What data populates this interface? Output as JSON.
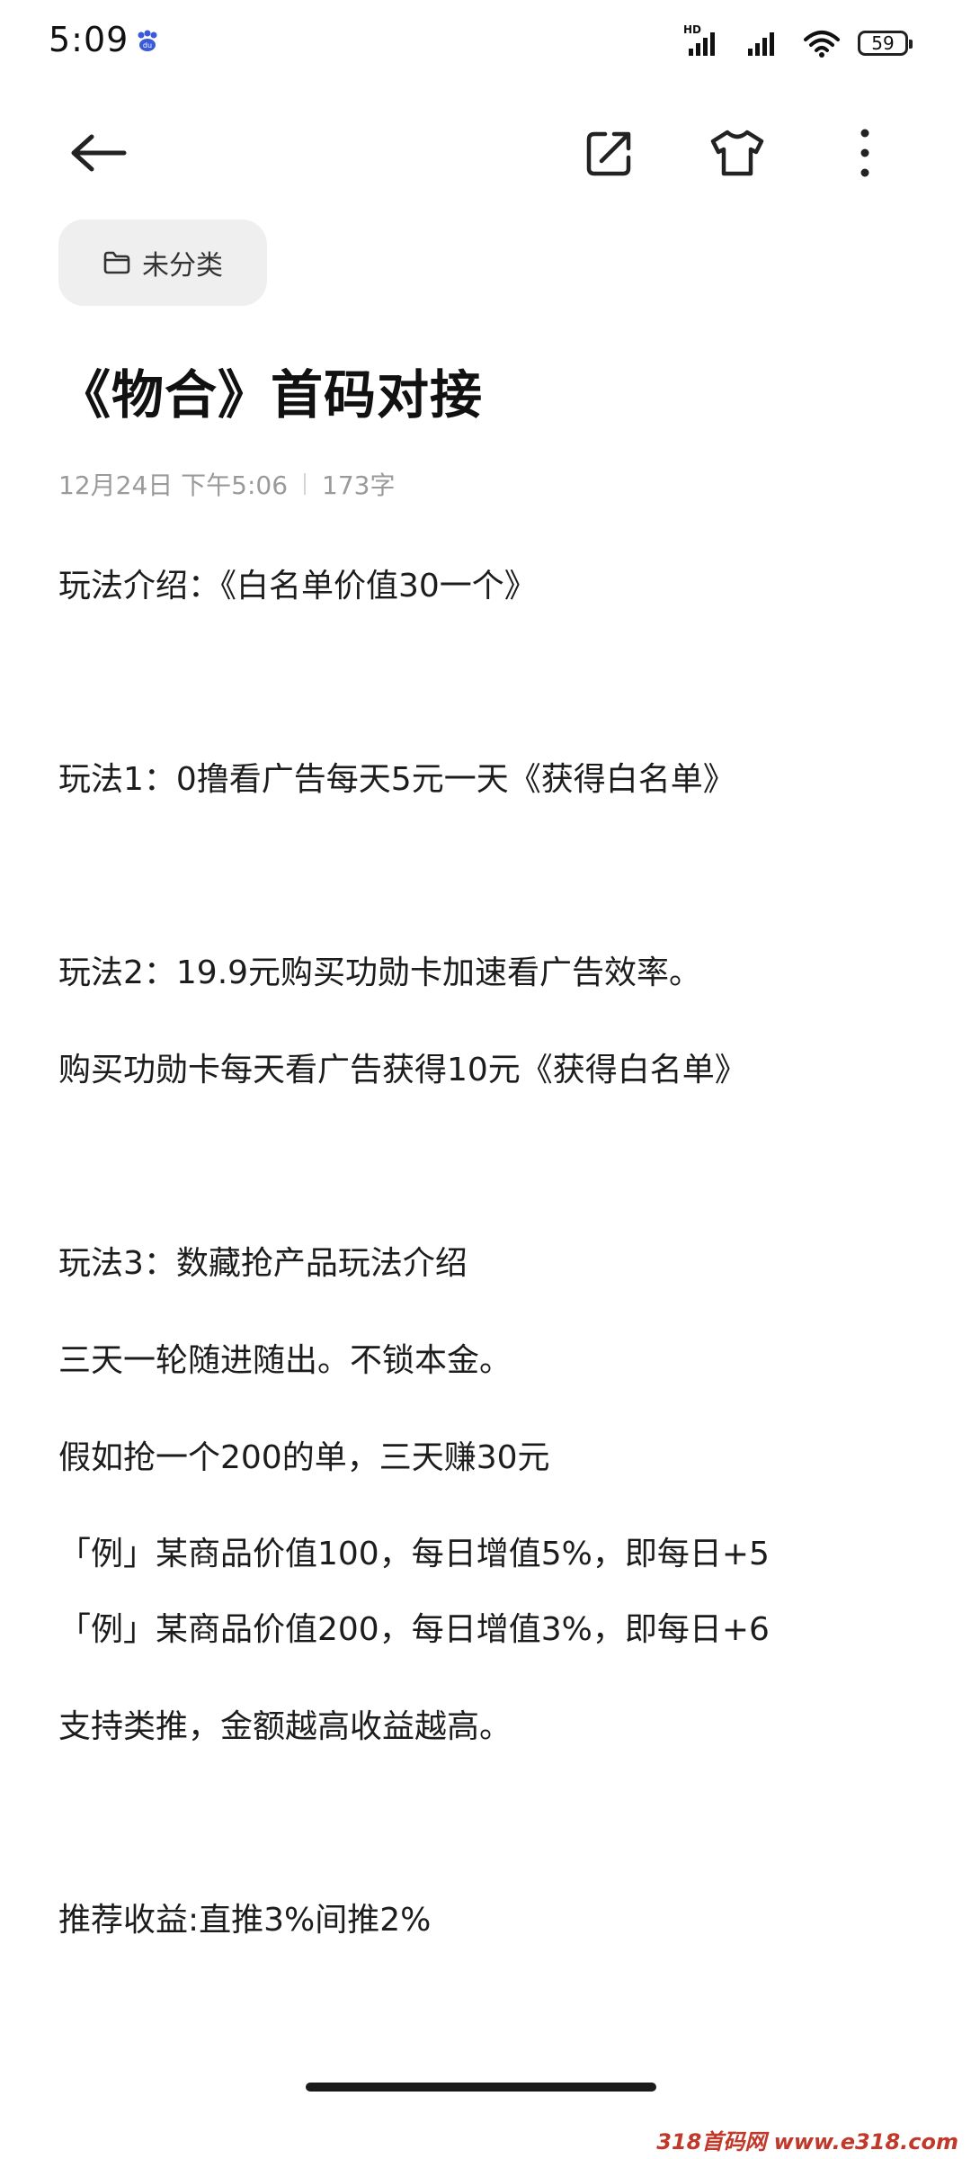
{
  "status_bar": {
    "time": "5:09",
    "battery": "59",
    "network_label": "HD"
  },
  "toolbar": {
    "back_icon": "arrow-left-icon",
    "share_icon": "share-external-icon",
    "theme_icon": "tshirt-icon",
    "more_icon": "more-vertical-icon"
  },
  "category": {
    "label": "未分类",
    "icon": "folder-icon"
  },
  "note": {
    "title": "《物合》首码对接",
    "date": "12月24日 下午5:06",
    "word_count": "173字",
    "lines": [
      "玩法介绍：《白名单价值30一个》",
      "玩法1：0撸看广告每天5元一天《获得白名单》",
      "玩法2：19.9元购买功勋卡加速看广告效率。",
      "购买功勋卡每天看广告获得10元《获得白名单》",
      "玩法3：数藏抢产品玩法介绍",
      "三天一轮随进随出。不锁本金。",
      "假如抢一个200的单，三天赚30元",
      "「例」某商品价值100，每日增值5%，即每日+5",
      "「例」某商品价值200，每日增值3%，即每日+6",
      "支持类推，金额越高收益越高。",
      "推荐收益:直推3%间推2%"
    ]
  },
  "watermark": "318首码网 www.e318.com"
}
